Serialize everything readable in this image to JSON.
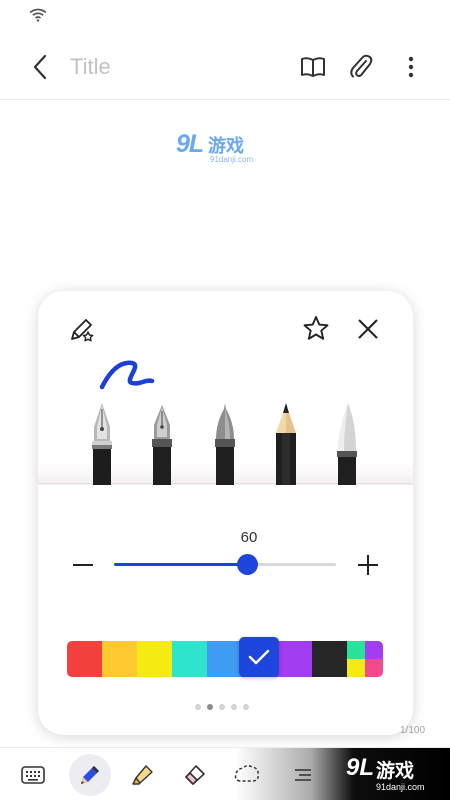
{
  "status_bar": {
    "wifi_icon": "wifi-icon"
  },
  "app_bar": {
    "back_icon": "chevron-left-icon",
    "title_placeholder": "Title",
    "actions": [
      "book-open-icon",
      "paperclip-icon",
      "more-vertical-icon"
    ]
  },
  "watermark": {
    "big": "9L",
    "cn": "游戏",
    "small": "91danji.com"
  },
  "pen_panel": {
    "favorite_icon": "pen-star-icon",
    "star_icon": "star-icon",
    "close_icon": "close-icon",
    "pens": [
      "fountain-pen-icon",
      "calligraphy-pen-icon",
      "brush-pen-icon",
      "pencil-icon",
      "marker-icon"
    ],
    "stroke_color": "#1b3fd8",
    "size": {
      "value": "60",
      "level": 0.6,
      "minus_icon": "minus-icon",
      "plus_icon": "plus-icon"
    },
    "palette": {
      "colors": [
        "#f43f3f",
        "#ffc930",
        "#f5ea12",
        "#2ee4cd",
        "#3e9cf2",
        "#1f46dc",
        "#a33df2",
        "#262626"
      ],
      "multi": [
        "#27e49a",
        "#a33df2",
        "#f5ea12",
        "#f24b8c"
      ],
      "selected_index": 5,
      "check_icon": "check-icon"
    },
    "pages": {
      "count": 5,
      "active": 1
    }
  },
  "page_indicator": "1/100",
  "toolbar": {
    "items": [
      "keyboard-icon",
      "pen-icon",
      "highlighter-icon",
      "eraser-icon",
      "lasso-icon",
      "more-tools-icon"
    ],
    "active": "pen"
  },
  "brand": {
    "big": "9L",
    "cn": "游戏",
    "small": "91danji.com"
  }
}
